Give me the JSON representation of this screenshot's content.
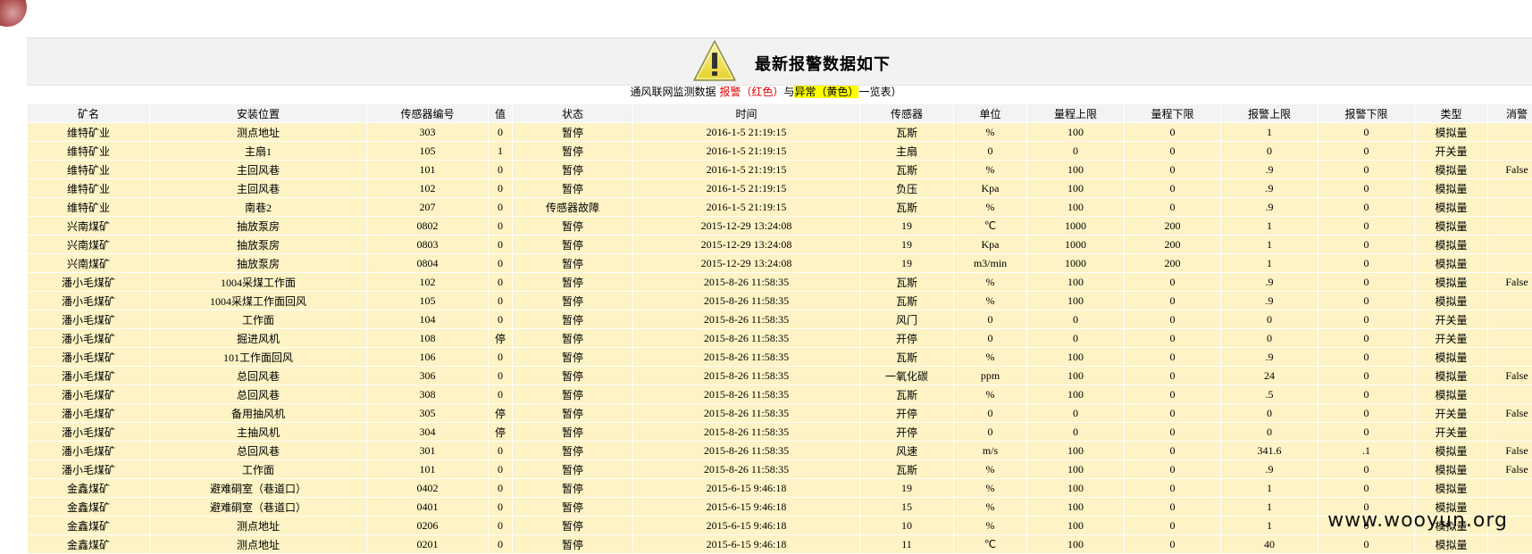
{
  "header": {
    "title": "最新报警数据如下",
    "subtitle_prefix": "通风联网监测数据",
    "subtitle_alarm": "报警（红色）",
    "subtitle_and": "与",
    "subtitle_abnormal": "异常（黄色）",
    "subtitle_suffix": "一览表）"
  },
  "table": {
    "columns": [
      "矿名",
      "安装位置",
      "传感器编号",
      "值",
      "状态",
      "时间",
      "传感器",
      "单位",
      "量程上限",
      "量程下限",
      "报警上限",
      "报警下限",
      "类型",
      "消警"
    ],
    "rows": [
      [
        "维特矿业",
        "测点地址",
        "303",
        "0",
        "暂停",
        "2016-1-5 21:19:15",
        "瓦斯",
        "%",
        "100",
        "0",
        "1",
        "0",
        "模拟量",
        ""
      ],
      [
        "维特矿业",
        "主扇1",
        "105",
        "1",
        "暂停",
        "2016-1-5 21:19:15",
        "主扇",
        "0",
        "0",
        "0",
        "0",
        "0",
        "开关量",
        ""
      ],
      [
        "维特矿业",
        "主回风巷",
        "101",
        "0",
        "暂停",
        "2016-1-5 21:19:15",
        "瓦斯",
        "%",
        "100",
        "0",
        ".9",
        "0",
        "模拟量",
        "False"
      ],
      [
        "维特矿业",
        "主回风巷",
        "102",
        "0",
        "暂停",
        "2016-1-5 21:19:15",
        "负压",
        "Kpa",
        "100",
        "0",
        ".9",
        "0",
        "模拟量",
        ""
      ],
      [
        "维特矿业",
        "南巷2",
        "207",
        "0",
        "传感器故障",
        "2016-1-5 21:19:15",
        "瓦斯",
        "%",
        "100",
        "0",
        ".9",
        "0",
        "模拟量",
        ""
      ],
      [
        "兴南煤矿",
        "抽放泵房",
        "0802",
        "0",
        "暂停",
        "2015-12-29 13:24:08",
        "19",
        "℃",
        "1000",
        "200",
        "1",
        "0",
        "模拟量",
        ""
      ],
      [
        "兴南煤矿",
        "抽放泵房",
        "0803",
        "0",
        "暂停",
        "2015-12-29 13:24:08",
        "19",
        "Kpa",
        "1000",
        "200",
        "1",
        "0",
        "模拟量",
        ""
      ],
      [
        "兴南煤矿",
        "抽放泵房",
        "0804",
        "0",
        "暂停",
        "2015-12-29 13:24:08",
        "19",
        "m3/min",
        "1000",
        "200",
        "1",
        "0",
        "模拟量",
        ""
      ],
      [
        "潘小毛煤矿",
        "1004采煤工作面",
        "102",
        "0",
        "暂停",
        "2015-8-26 11:58:35",
        "瓦斯",
        "%",
        "100",
        "0",
        ".9",
        "0",
        "模拟量",
        "False"
      ],
      [
        "潘小毛煤矿",
        "1004采煤工作面回风",
        "105",
        "0",
        "暂停",
        "2015-8-26 11:58:35",
        "瓦斯",
        "%",
        "100",
        "0",
        ".9",
        "0",
        "模拟量",
        ""
      ],
      [
        "潘小毛煤矿",
        "工作面",
        "104",
        "0",
        "暂停",
        "2015-8-26 11:58:35",
        "风门",
        "0",
        "0",
        "0",
        "0",
        "0",
        "开关量",
        ""
      ],
      [
        "潘小毛煤矿",
        "掘进风机",
        "108",
        "停",
        "暂停",
        "2015-8-26 11:58:35",
        "开停",
        "0",
        "0",
        "0",
        "0",
        "0",
        "开关量",
        ""
      ],
      [
        "潘小毛煤矿",
        "101工作面回风",
        "106",
        "0",
        "暂停",
        "2015-8-26 11:58:35",
        "瓦斯",
        "%",
        "100",
        "0",
        ".9",
        "0",
        "模拟量",
        ""
      ],
      [
        "潘小毛煤矿",
        "总回风巷",
        "306",
        "0",
        "暂停",
        "2015-8-26 11:58:35",
        "一氧化碳",
        "ppm",
        "100",
        "0",
        "24",
        "0",
        "模拟量",
        "False"
      ],
      [
        "潘小毛煤矿",
        "总回风巷",
        "308",
        "0",
        "暂停",
        "2015-8-26 11:58:35",
        "瓦斯",
        "%",
        "100",
        "0",
        ".5",
        "0",
        "模拟量",
        ""
      ],
      [
        "潘小毛煤矿",
        "备用抽风机",
        "305",
        "停",
        "暂停",
        "2015-8-26 11:58:35",
        "开停",
        "0",
        "0",
        "0",
        "0",
        "0",
        "开关量",
        "False"
      ],
      [
        "潘小毛煤矿",
        "主抽风机",
        "304",
        "停",
        "暂停",
        "2015-8-26 11:58:35",
        "开停",
        "0",
        "0",
        "0",
        "0",
        "0",
        "开关量",
        ""
      ],
      [
        "潘小毛煤矿",
        "总回风巷",
        "301",
        "0",
        "暂停",
        "2015-8-26 11:58:35",
        "风速",
        "m/s",
        "100",
        "0",
        "341.6",
        ".1",
        "模拟量",
        "False"
      ],
      [
        "潘小毛煤矿",
        "工作面",
        "101",
        "0",
        "暂停",
        "2015-8-26 11:58:35",
        "瓦斯",
        "%",
        "100",
        "0",
        ".9",
        "0",
        "模拟量",
        "False"
      ],
      [
        "金鑫煤矿",
        "避难硐室（巷道口）",
        "0402",
        "0",
        "暂停",
        "2015-6-15 9:46:18",
        "19",
        "%",
        "100",
        "0",
        "1",
        "0",
        "模拟量",
        ""
      ],
      [
        "金鑫煤矿",
        "避难硐室（巷道口）",
        "0401",
        "0",
        "暂停",
        "2015-6-15 9:46:18",
        "15",
        "%",
        "100",
        "0",
        "1",
        "0",
        "模拟量",
        ""
      ],
      [
        "金鑫煤矿",
        "测点地址",
        "0206",
        "0",
        "暂停",
        "2015-6-15 9:46:18",
        "10",
        "%",
        "100",
        "0",
        "1",
        "0",
        "模拟量",
        ""
      ],
      [
        "金鑫煤矿",
        "测点地址",
        "0201",
        "0",
        "暂停",
        "2015-6-15 9:46:18",
        "11",
        "℃",
        "100",
        "0",
        "40",
        "0",
        "模拟量",
        ""
      ]
    ]
  },
  "watermark": "www.wooyun.org",
  "colors": {
    "row_bg": "#fdf3c4",
    "header_bg": "#f3f3f3",
    "alarm_red": "#e00000",
    "abnormal_yellow": "#ffff00",
    "warning_icon_fill": "#f3e646"
  }
}
